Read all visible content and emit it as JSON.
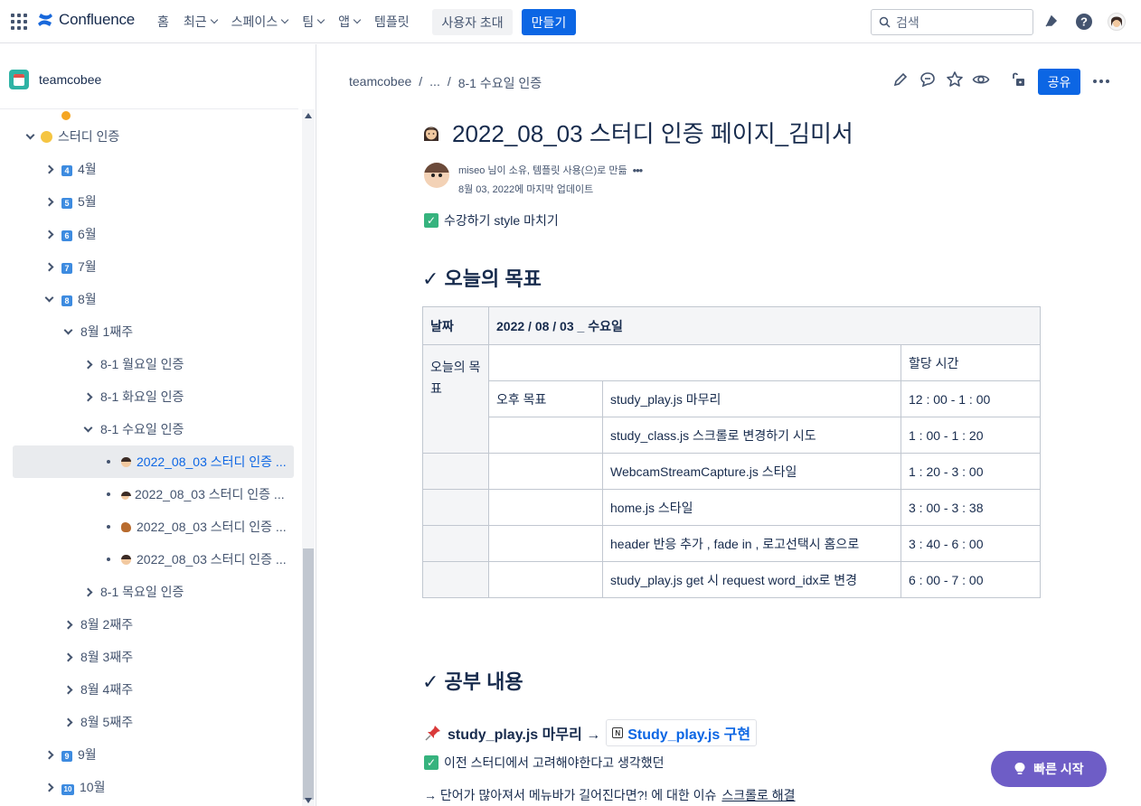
{
  "topbar": {
    "app_name": "Confluence",
    "nav": [
      "홈",
      "최근",
      "스페이스",
      "팀",
      "앱",
      "템플릿"
    ],
    "invite_label": "사용자 초대",
    "create_label": "만들기",
    "search_placeholder": "검색"
  },
  "sidebar": {
    "space_name": "teamcobee",
    "items": [
      {
        "label": "스터디 인증",
        "level": 1,
        "state": "expanded"
      },
      {
        "label": "4월",
        "level": 2,
        "badge": "4",
        "state": "collapsed"
      },
      {
        "label": "5월",
        "level": 2,
        "badge": "5",
        "state": "collapsed"
      },
      {
        "label": "6월",
        "level": 2,
        "badge": "6",
        "state": "collapsed"
      },
      {
        "label": "7월",
        "level": 2,
        "badge": "7",
        "state": "collapsed"
      },
      {
        "label": "8월",
        "level": 2,
        "badge": "8",
        "state": "expanded"
      },
      {
        "label": "8월 1째주",
        "level": 3,
        "state": "expanded"
      },
      {
        "label": "8-1 월요일 인증",
        "level": 4,
        "state": "collapsed"
      },
      {
        "label": "8-1 화요일 인증",
        "level": 4,
        "state": "collapsed"
      },
      {
        "label": "8-1 수요일 인증",
        "level": 4,
        "state": "expanded"
      },
      {
        "label": "2022_08_03 스터디 인증 ...",
        "level": 5,
        "state": "leaf",
        "selected": true
      },
      {
        "label": "2022_08_03 스터디 인증 ...",
        "level": 5,
        "state": "leaf"
      },
      {
        "label": "2022_08_03 스터디 인증 ...",
        "level": 5,
        "state": "leaf"
      },
      {
        "label": "2022_08_03 스터디 인증 ...",
        "level": 5,
        "state": "leaf"
      },
      {
        "label": "8-1 목요일 인증",
        "level": 4,
        "state": "collapsed"
      },
      {
        "label": "8월 2째주",
        "level": 3,
        "state": "collapsed"
      },
      {
        "label": "8월 3째주",
        "level": 3,
        "state": "collapsed"
      },
      {
        "label": "8월 4째주",
        "level": 3,
        "state": "collapsed"
      },
      {
        "label": "8월 5째주",
        "level": 3,
        "state": "collapsed"
      },
      {
        "label": "9월",
        "level": 2,
        "badge": "9",
        "state": "collapsed"
      },
      {
        "label": "10월",
        "level": 2,
        "badge": "10",
        "state": "collapsed"
      }
    ]
  },
  "breadcrumb": [
    "teamcobee",
    "/",
    "...",
    "/",
    "8-1 수요일 인증"
  ],
  "page_actions": {
    "share_label": "공유"
  },
  "page": {
    "title": "2022_08_03 스터디 인증 페이지_김미서",
    "byline_owner": "miseo 님이 소유, 템플릿 사용(으)로 만듦",
    "byline_updated": "8월 03, 2022에 마지막 업데이트",
    "intro": "수강하기 style 마치기",
    "heading_goals": "✓ 오늘의 목표",
    "table": {
      "header_date": "날짜",
      "header_value": "2022 / 08 / 03 _ 수요일",
      "side_label": "오늘의 목표",
      "time_header": "할당 시간",
      "period_label": "오후 목표",
      "rows": [
        {
          "task": "study_play.js 마무리",
          "time": "12 : 00 - 1 : 00"
        },
        {
          "task": "study_class.js 스크롤로 변경하기 시도",
          "time": "1 : 00 - 1 : 20"
        },
        {
          "task": "WebcamStreamCapture.js 스타일",
          "time": "1 : 20 - 3 : 00"
        },
        {
          "task": "home.js 스타일",
          "time": "3 : 00 - 3 : 38"
        },
        {
          "task": "header 반응 추가 , fade in , 로고선택시 홈으로",
          "time": "3 : 40 - 6 : 00"
        },
        {
          "task": "study_play.js get 시 request word_idx로 변경",
          "time": "6 : 00 - 7 : 00"
        }
      ]
    },
    "heading_study": "✓ 공부 내용",
    "study_item_prefix": "study_play.js 마무리 →",
    "study_item_link": "Study_play.js 구현",
    "study_line2": "이전 스터디에서 고려해야한다고 생각했던",
    "study_line3_prefix": "→ 단어가 많아져서 메뉴바가 길어진다면?! 에 대한 이슈",
    "study_line3_link": "스크롤로 해결"
  },
  "quick_start_label": "빠른 시작",
  "colors": {
    "primary": "#0c66e4",
    "quick_start": "#6e5dc6",
    "success": "#36b37e"
  }
}
